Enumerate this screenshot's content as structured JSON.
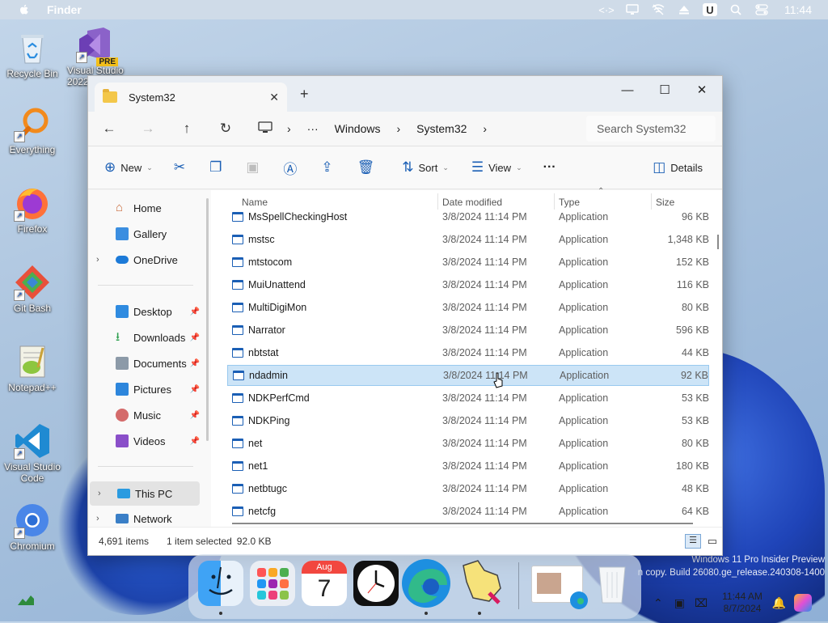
{
  "menubar": {
    "app_name": "Finder",
    "clock": "11:44",
    "icons": [
      "apple-icon",
      "code-icon",
      "display-icon",
      "network-off-icon",
      "eject-icon",
      "u-icon",
      "search-icon",
      "control-center-icon"
    ]
  },
  "desktop": {
    "icons": [
      {
        "label": "Recycle Bin",
        "icon": "recycle-bin-icon"
      },
      {
        "label": "Visual Studio 2022",
        "icon": "visual-studio-icon",
        "badge": "PRE"
      },
      {
        "label": "Everything",
        "icon": "everything-icon"
      },
      {
        "label": "Firefox",
        "icon": "firefox-icon"
      },
      {
        "label": "Git Bash",
        "icon": "git-bash-icon"
      },
      {
        "label": "Notepad++",
        "icon": "notepad-plus-plus-icon"
      },
      {
        "label": "Visual Studio Code",
        "icon": "vscode-icon"
      },
      {
        "label": "Chromium",
        "icon": "chromium-icon"
      }
    ],
    "watermark": {
      "line1": "Windows 11 Pro Insider Preview",
      "line2": "n copy. Build 26080.ge_release.240308-1400"
    }
  },
  "explorer": {
    "tab_title": "System32",
    "new_tab": "+",
    "window_controls": {
      "minimize": "—",
      "maximize": "☐",
      "close": "✕"
    },
    "breadcrumb": {
      "more": "···",
      "items": [
        "Windows",
        "System32"
      ]
    },
    "search_placeholder": "Search System32",
    "toolbar": {
      "new": "New",
      "sort": "Sort",
      "view": "View",
      "more": "···",
      "details": "Details"
    },
    "nav": {
      "items": [
        {
          "label": "Home",
          "icon": "home-icon"
        },
        {
          "label": "Gallery",
          "icon": "gallery-icon"
        },
        {
          "label": "OneDrive",
          "icon": "onedrive-icon"
        },
        {
          "label": "Desktop",
          "icon": "desktop-folder-icon"
        },
        {
          "label": "Downloads",
          "icon": "downloads-icon"
        },
        {
          "label": "Documents",
          "icon": "documents-icon"
        },
        {
          "label": "Pictures",
          "icon": "pictures-icon"
        },
        {
          "label": "Music",
          "icon": "music-icon"
        },
        {
          "label": "Videos",
          "icon": "videos-icon"
        },
        {
          "label": "This PC",
          "icon": "this-pc-icon"
        },
        {
          "label": "Network",
          "icon": "network-icon"
        }
      ]
    },
    "columns": {
      "name": "Name",
      "date": "Date modified",
      "type": "Type",
      "size": "Size"
    },
    "files": [
      {
        "name": "MsSpellCheckingHost",
        "date": "3/8/2024 11:14 PM",
        "type": "Application",
        "size": "96 KB"
      },
      {
        "name": "mstsc",
        "date": "3/8/2024 11:14 PM",
        "type": "Application",
        "size": "1,348 KB"
      },
      {
        "name": "mtstocom",
        "date": "3/8/2024 11:14 PM",
        "type": "Application",
        "size": "152 KB"
      },
      {
        "name": "MuiUnattend",
        "date": "3/8/2024 11:14 PM",
        "type": "Application",
        "size": "116 KB"
      },
      {
        "name": "MultiDigiMon",
        "date": "3/8/2024 11:14 PM",
        "type": "Application",
        "size": "80 KB"
      },
      {
        "name": "Narrator",
        "date": "3/8/2024 11:14 PM",
        "type": "Application",
        "size": "596 KB"
      },
      {
        "name": "nbtstat",
        "date": "3/8/2024 11:14 PM",
        "type": "Application",
        "size": "44 KB"
      },
      {
        "name": "ndadmin",
        "date": "3/8/2024 11:14 PM",
        "type": "Application",
        "size": "92 KB"
      },
      {
        "name": "NDKPerfCmd",
        "date": "3/8/2024 11:14 PM",
        "type": "Application",
        "size": "53 KB"
      },
      {
        "name": "NDKPing",
        "date": "3/8/2024 11:14 PM",
        "type": "Application",
        "size": "53 KB"
      },
      {
        "name": "net",
        "date": "3/8/2024 11:14 PM",
        "type": "Application",
        "size": "80 KB"
      },
      {
        "name": "net1",
        "date": "3/8/2024 11:14 PM",
        "type": "Application",
        "size": "180 KB"
      },
      {
        "name": "netbtugc",
        "date": "3/8/2024 11:14 PM",
        "type": "Application",
        "size": "48 KB"
      },
      {
        "name": "netcfg",
        "date": "3/8/2024 11:14 PM",
        "type": "Application",
        "size": "64 KB"
      }
    ],
    "status": {
      "items": "4,691 items",
      "selected": "1 item selected",
      "size": "92.0 KB"
    }
  },
  "dock": {
    "calendar": {
      "month": "Aug",
      "day": "7"
    },
    "apps": [
      "finder-icon",
      "launchpad-icon",
      "calendar-icon",
      "clock-icon",
      "edge-icon",
      "pointer-app-icon",
      "edge-window-thumbnail",
      "trash-icon"
    ]
  },
  "tray": {
    "time": "11:44 AM",
    "date": "8/7/2024"
  }
}
